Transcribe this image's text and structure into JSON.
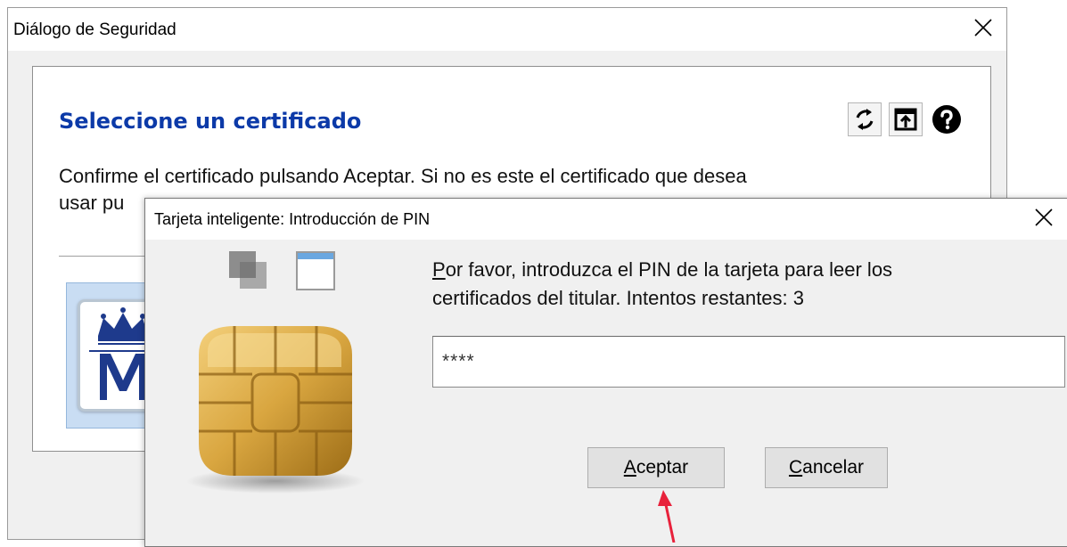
{
  "security_dialog": {
    "title": "Diálogo de Seguridad",
    "heading": "Seleccione un certificado",
    "message_line1": "Confirme el certificado pulsando Aceptar. Si no es este el certificado que desea",
    "message_line2": "usar pu",
    "toolbar_icons": [
      "refresh-icon",
      "open-file-icon",
      "help-icon"
    ]
  },
  "pin_dialog": {
    "title": "Tarjeta inteligente: Introducción de PIN",
    "prompt_first_letter": "P",
    "prompt_line1_rest": "or favor, introduzca el PIN de la tarjeta para leer los",
    "prompt_line2": "certificados del titular. Intentos restantes: 3",
    "pin_value": "****",
    "accept_first_letter": "A",
    "accept_rest": "ceptar",
    "cancel_first_letter": "C",
    "cancel_rest": "ancelar"
  },
  "colors": {
    "heading": "#0c3aa8",
    "chip_gold": "#d9a640",
    "annotation_arrow": "#e8213b",
    "selection": "#c9ddf3"
  }
}
